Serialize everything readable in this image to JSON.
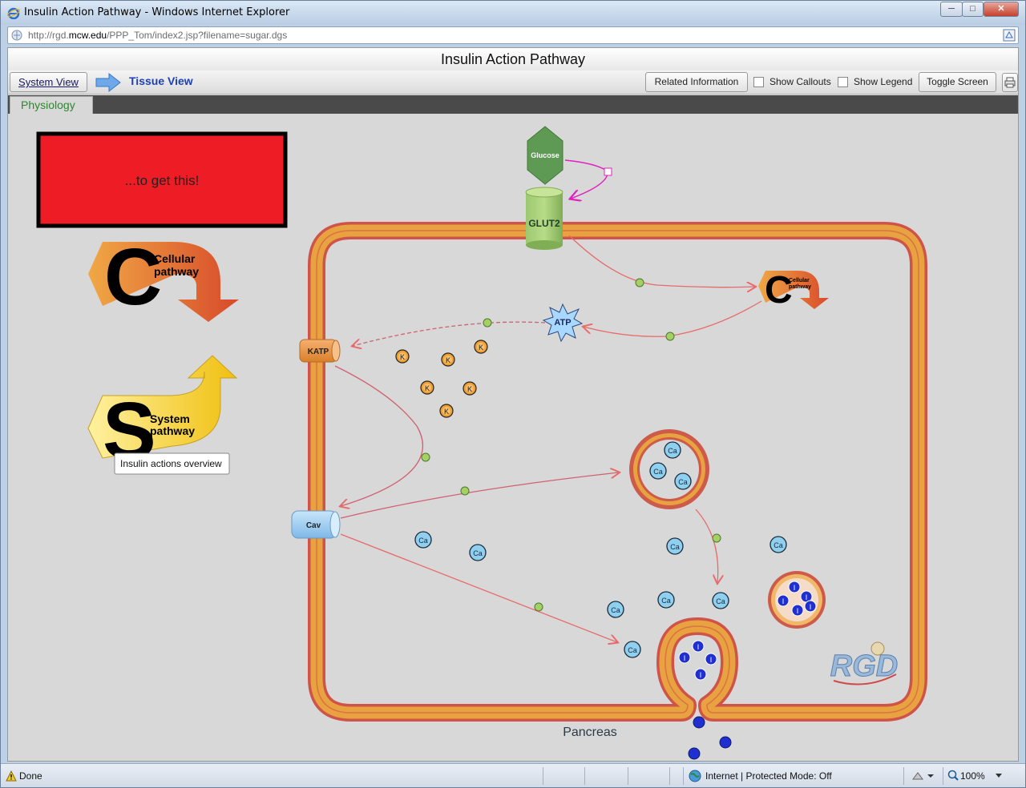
{
  "browser": {
    "window_title": "Insulin Action Pathway - Windows Internet Explorer",
    "url_prefix": "http://rgd.",
    "url_domain": "mcw.edu",
    "url_path": "/PPP_Tom/index2.jsp?filename=sugar.dgs",
    "status_left": "Done",
    "status_zone": "Internet | Protected Mode: Off",
    "zoom": "100%"
  },
  "app": {
    "title": "Insulin Action Pathway",
    "system_view_label": "System View",
    "tissue_view_label": "Tissue View",
    "related_info_label": "Related Information",
    "show_callouts_label": "Show Callouts",
    "show_legend_label": "Show Legend",
    "toggle_screen_label": "Toggle Screen",
    "tab_label": "Physiology"
  },
  "diagram": {
    "red_box_text": "...to get this!",
    "cellular_pathway_letter": "C",
    "cellular_pathway_line1": "Cellular",
    "cellular_pathway_line2": "pathway",
    "system_pathway_letter": "S",
    "system_pathway_line1": "System",
    "system_pathway_line2": "pathway",
    "tooltip": "Insulin actions overview",
    "glucose_label": "Glucose",
    "glut2_label": "GLUT2",
    "atp_label": "ATP",
    "katp_label": "KATP",
    "cav_label": "Cav",
    "potassium_label": "K",
    "calcium_label": "Ca",
    "insulin_label": "I",
    "small_cellular_line1": "Cellular",
    "small_cellular_line2": "pathway",
    "tissue_label": "Pancreas",
    "logo_text": "RGD",
    "colors": {
      "membrane": "#e8a23f",
      "membrane_edge": "#d0534a",
      "arrow": "#e86a6a",
      "red_box": "#ee1c25",
      "calcium_fill": "#8fd0f0",
      "potassium_fill": "#f0a030",
      "insulin_fill": "#2030d0"
    }
  }
}
